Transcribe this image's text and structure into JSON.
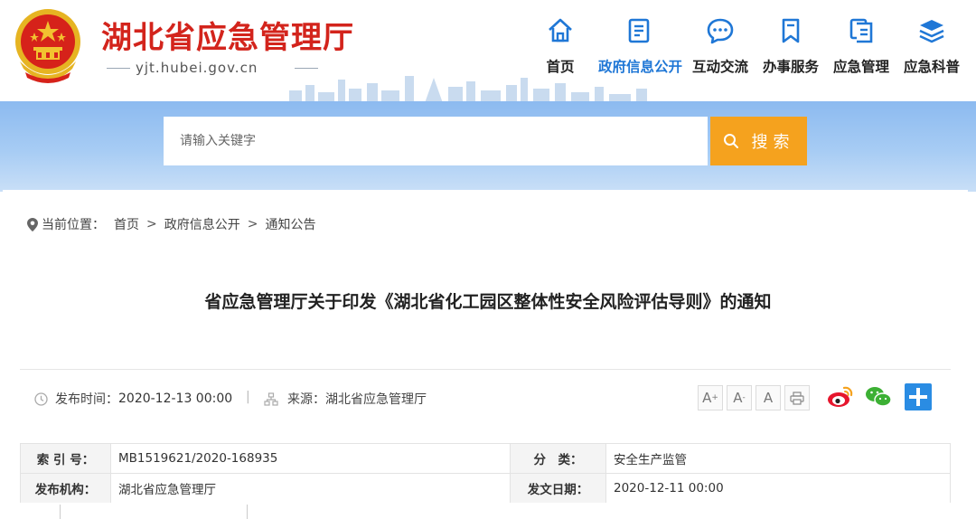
{
  "site": {
    "title": "湖北省应急管理厅",
    "domain": "yjt.hubei.gov.cn"
  },
  "nav": {
    "items": [
      {
        "label": "首页",
        "icon": "home-icon"
      },
      {
        "label": "政府信息公开",
        "icon": "document-icon",
        "active": true
      },
      {
        "label": "互动交流",
        "icon": "chat-icon"
      },
      {
        "label": "办事服务",
        "icon": "bookmark-icon"
      },
      {
        "label": "应急管理",
        "icon": "files-icon"
      },
      {
        "label": "应急科普",
        "icon": "layers-icon"
      }
    ]
  },
  "search": {
    "placeholder": "请输入关键字",
    "button_label": "搜索"
  },
  "breadcrumb": {
    "label": "当前位置：",
    "items": [
      "首页",
      "政府信息公开",
      "通知公告"
    ],
    "separator": ">"
  },
  "article": {
    "title": "省应急管理厅关于印发《湖北省化工园区整体性安全风险评估导则》的通知",
    "publish_time_label": "发布时间：",
    "publish_time": "2020-12-13 00:00",
    "divider": "|",
    "source_label": "来源：",
    "source": "湖北省应急管理厅"
  },
  "tools": {
    "font_large": "A",
    "font_medium": "A",
    "font_small": "A",
    "print_icon": "printer-icon"
  },
  "share": [
    "weibo-icon",
    "wechat-icon",
    "plus-share-icon"
  ],
  "info_table": {
    "rows": [
      {
        "k1": "索 引 号：",
        "v1": "MB1519621/2020-168935",
        "k2": "分　类：",
        "v2": "安全生产监管"
      },
      {
        "k1": "发布机构：",
        "v1": "湖北省应急管理厅",
        "k2": "发文日期：",
        "v2": "2020-12-11 00:00"
      }
    ]
  },
  "colors": {
    "brand_red": "#d3241c",
    "nav_active": "#1f77d6",
    "search_button": "#f5a21e",
    "band": "#a7ccf4"
  }
}
